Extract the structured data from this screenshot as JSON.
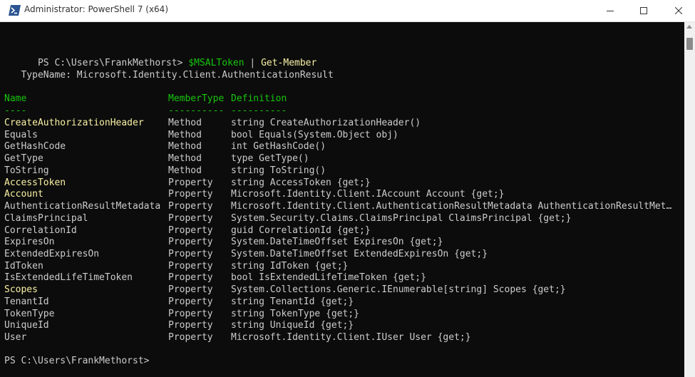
{
  "window": {
    "title": "Administrator: PowerShell 7 (x64)"
  },
  "console": {
    "prompt1": {
      "prompt": "PS C:\\Users\\FrankMethorst> ",
      "variable": "$MSALToken",
      "pipe": " | ",
      "command": "Get-Member"
    },
    "typename": "   TypeName: Microsoft.Identity.Client.AuthenticationResult",
    "headers": {
      "name": "Name",
      "membertype": "MemberType",
      "definition": "Definition"
    },
    "separators": {
      "name": "----",
      "membertype": "----------",
      "definition": "----------"
    },
    "members": [
      {
        "name": "CreateAuthorizationHeader",
        "type": "Method",
        "definition": "string CreateAuthorizationHeader()",
        "highlight": true
      },
      {
        "name": "Equals",
        "type": "Method",
        "definition": "bool Equals(System.Object obj)",
        "highlight": false
      },
      {
        "name": "GetHashCode",
        "type": "Method",
        "definition": "int GetHashCode()",
        "highlight": false
      },
      {
        "name": "GetType",
        "type": "Method",
        "definition": "type GetType()",
        "highlight": false
      },
      {
        "name": "ToString",
        "type": "Method",
        "definition": "string ToString()",
        "highlight": false
      },
      {
        "name": "AccessToken",
        "type": "Property",
        "definition": "string AccessToken {get;}",
        "highlight": true
      },
      {
        "name": "Account",
        "type": "Property",
        "definition": "Microsoft.Identity.Client.IAccount Account {get;}",
        "highlight": true
      },
      {
        "name": "AuthenticationResultMetadata",
        "type": "Property",
        "definition": "Microsoft.Identity.Client.AuthenticationResultMetadata AuthenticationResultMet…",
        "highlight": false
      },
      {
        "name": "ClaimsPrincipal",
        "type": "Property",
        "definition": "System.Security.Claims.ClaimsPrincipal ClaimsPrincipal {get;}",
        "highlight": false
      },
      {
        "name": "CorrelationId",
        "type": "Property",
        "definition": "guid CorrelationId {get;}",
        "highlight": false
      },
      {
        "name": "ExpiresOn",
        "type": "Property",
        "definition": "System.DateTimeOffset ExpiresOn {get;}",
        "highlight": false
      },
      {
        "name": "ExtendedExpiresOn",
        "type": "Property",
        "definition": "System.DateTimeOffset ExtendedExpiresOn {get;}",
        "highlight": false
      },
      {
        "name": "IdToken",
        "type": "Property",
        "definition": "string IdToken {get;}",
        "highlight": false
      },
      {
        "name": "IsExtendedLifeTimeToken",
        "type": "Property",
        "definition": "bool IsExtendedLifeTimeToken {get;}",
        "highlight": false
      },
      {
        "name": "Scopes",
        "type": "Property",
        "definition": "System.Collections.Generic.IEnumerable[string] Scopes {get;}",
        "highlight": true
      },
      {
        "name": "TenantId",
        "type": "Property",
        "definition": "string TenantId {get;}",
        "highlight": false
      },
      {
        "name": "TokenType",
        "type": "Property",
        "definition": "string TokenType {get;}",
        "highlight": false
      },
      {
        "name": "UniqueId",
        "type": "Property",
        "definition": "string UniqueId {get;}",
        "highlight": false
      },
      {
        "name": "User",
        "type": "Property",
        "definition": "Microsoft.Identity.Client.IUser User {get;}",
        "highlight": false
      }
    ],
    "prompt2": "PS C:\\Users\\FrankMethorst> "
  },
  "colors": {
    "background": "#0c0c0c",
    "text": "#cccccc",
    "highlight": "#f9f1a5",
    "header": "#16c60c"
  },
  "icons": {
    "app": "powershell-icon",
    "minimize": "minimize-icon",
    "maximize": "maximize-icon",
    "close": "close-icon"
  }
}
